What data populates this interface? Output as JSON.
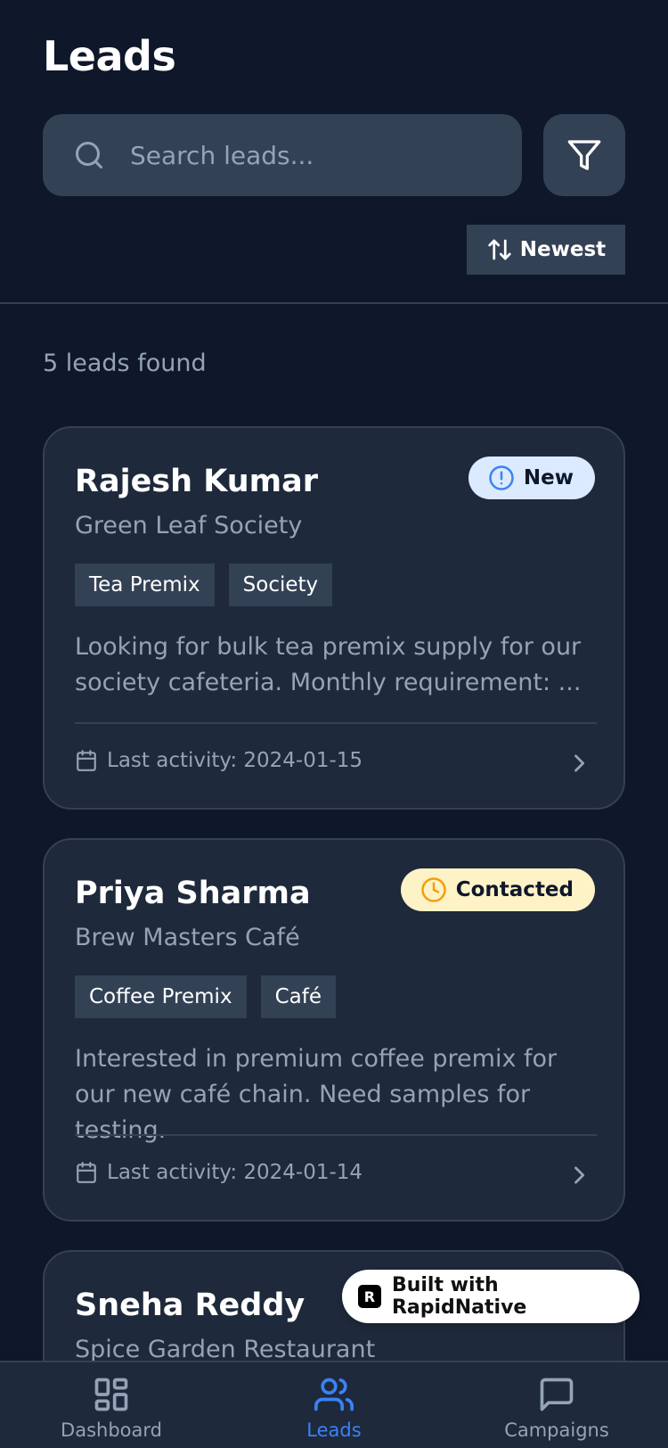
{
  "header": {
    "title": "Leads",
    "search_placeholder": "Search leads...",
    "sort_label": "Newest"
  },
  "results": {
    "count_text": "5 leads found"
  },
  "leads": [
    {
      "name": "Rajesh Kumar",
      "company": "Green Leaf Society",
      "status": "New",
      "tags": [
        "Tea Premix",
        "Society"
      ],
      "description": "Looking for bulk tea premix supply for our society cafeteria. Monthly requirement: ...",
      "last_activity": "Last activity: 2024-01-15"
    },
    {
      "name": "Priya Sharma",
      "company": "Brew Masters Café",
      "status": "Contacted",
      "tags": [
        "Coffee Premix",
        "Café"
      ],
      "description": "Interested in premium coffee premix for our new café chain. Need samples for testing.",
      "last_activity": "Last activity: 2024-01-14"
    },
    {
      "name": "Sneha Reddy",
      "company": "Spice Garden Restaurant"
    }
  ],
  "tabs": [
    {
      "label": "Dashboard",
      "icon": "dashboard-icon",
      "active": false
    },
    {
      "label": "Leads",
      "icon": "users-icon",
      "active": true
    },
    {
      "label": "Campaigns",
      "icon": "message-icon",
      "active": false
    }
  ],
  "watermark": {
    "text": "Built with RapidNative",
    "logo": "R"
  },
  "colors": {
    "background": "#0f172a",
    "surface": "#1e293b",
    "border": "#334155",
    "muted_text": "#94a3b8",
    "accent": "#3b82f6",
    "status_new_bg": "#dbeafe",
    "status_new_icon": "#3b82f6",
    "status_contacted_bg": "#fef3c7",
    "status_contacted_icon": "#f59e0b"
  }
}
